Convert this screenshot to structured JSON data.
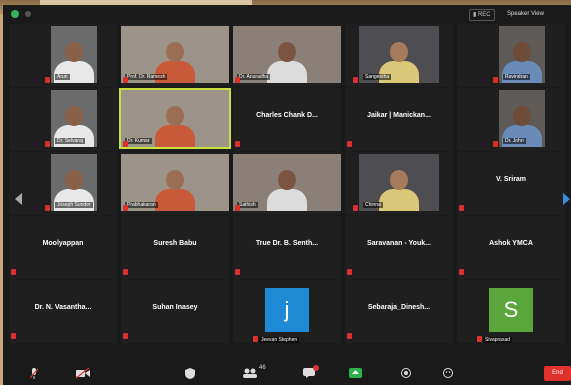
{
  "window": {
    "recording_badge": "▮ REC",
    "view_button": "Speaker View"
  },
  "colors": {
    "active_speaker": "#c9e03d",
    "mute_red": "#d9302c",
    "avatar_blue": "#1e8ad6",
    "avatar_green": "#5aa63a",
    "end_red": "#e0322c"
  },
  "participants": [
    {
      "name": "Arun",
      "type": "video"
    },
    {
      "name": "Prof. Dr. Ramesh",
      "type": "video"
    },
    {
      "name": "Dr. Anuradha",
      "type": "video"
    },
    {
      "name": "Sangeetha",
      "type": "video"
    },
    {
      "name": "Ravindran",
      "type": "video"
    },
    {
      "name": "Dr. Selvaraj",
      "type": "video"
    },
    {
      "name": "Dr. Kumar",
      "type": "video",
      "active": true
    },
    {
      "name": "Charles Chank D...",
      "type": "name"
    },
    {
      "name": "Jaikar | Manickan...",
      "type": "name"
    },
    {
      "name": "Dr. John",
      "type": "video"
    },
    {
      "name": "Joseph Sunder",
      "type": "video"
    },
    {
      "name": "Prabhakaran",
      "type": "video"
    },
    {
      "name": "Sathish",
      "type": "video"
    },
    {
      "name": "Chinna",
      "type": "video"
    },
    {
      "name": "V. Sriram",
      "type": "name"
    },
    {
      "name": "Moolyappan",
      "type": "name"
    },
    {
      "name": "Suresh Babu",
      "type": "name"
    },
    {
      "name": "True Dr. B. Senth...",
      "type": "name"
    },
    {
      "name": "Saravanan - Youk...",
      "type": "name"
    },
    {
      "name": "Ashok YMCA",
      "type": "name"
    },
    {
      "name": "Dr. N. Vasantha...",
      "type": "name"
    },
    {
      "name": "Suhan Inasey",
      "type": "name"
    },
    {
      "name": "Jeevan Stephen",
      "type": "avatar",
      "letter": "j"
    },
    {
      "name": "Sebaraja_Dinesh...",
      "type": "name"
    },
    {
      "name": "Sivaprasad",
      "type": "avatar",
      "letter": "S"
    }
  ],
  "toolbar": {
    "unmute": "Unmute",
    "video": "Start Video",
    "security": "Security",
    "participants": "Participants",
    "participants_count": "46",
    "chat": "Chat",
    "share": "Share Screen",
    "record": "Record",
    "reactions": "Reactions",
    "end": "End"
  }
}
